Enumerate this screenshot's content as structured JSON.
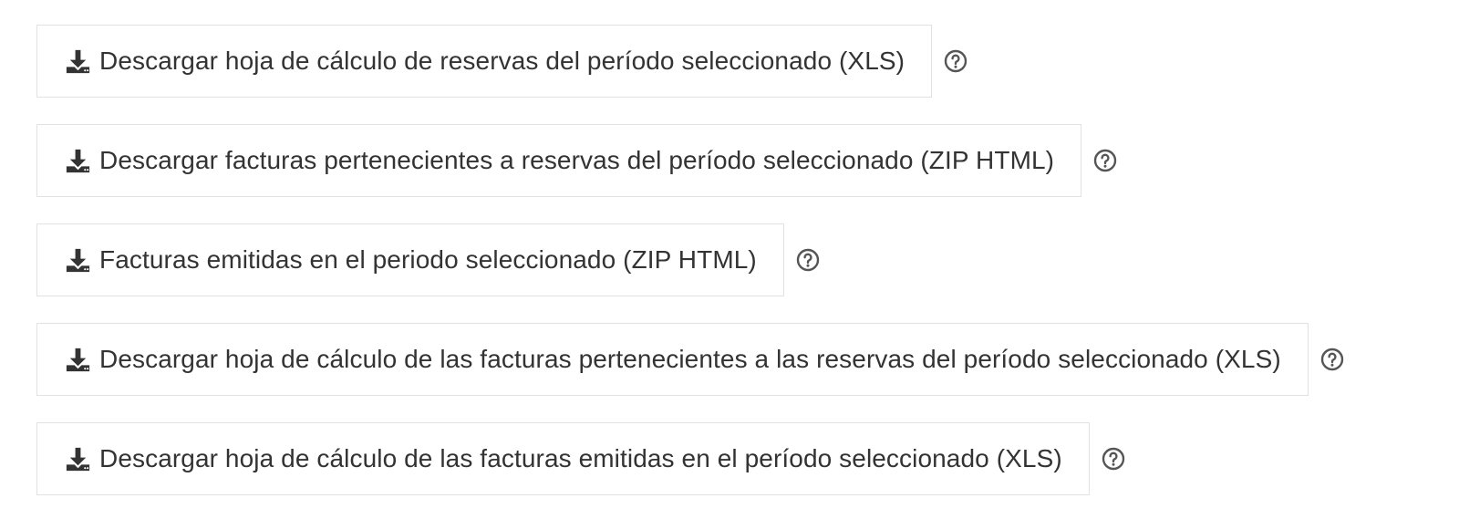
{
  "downloads": [
    {
      "label": "Descargar hoja de cálculo de reservas del período seleccionado (XLS)",
      "icon": "download-icon",
      "help_icon": "help-icon"
    },
    {
      "label": "Descargar facturas pertenecientes a reservas del período seleccionado (ZIP HTML)",
      "icon": "download-icon",
      "help_icon": "help-icon"
    },
    {
      "label": "Facturas emitidas en el periodo seleccionado (ZIP HTML)",
      "icon": "download-icon",
      "help_icon": "help-icon"
    },
    {
      "label": "Descargar hoja de cálculo de las facturas pertenecientes a las reservas del período seleccionado (XLS)",
      "icon": "download-icon",
      "help_icon": "help-icon"
    },
    {
      "label": "Descargar hoja de cálculo de las facturas emitidas en el período seleccionado (XLS)",
      "icon": "download-icon",
      "help_icon": "help-icon"
    }
  ],
  "colors": {
    "text": "#333333",
    "border": "#e2e2e2",
    "icon": "#333333",
    "help_icon": "#555555",
    "background": "#ffffff"
  }
}
